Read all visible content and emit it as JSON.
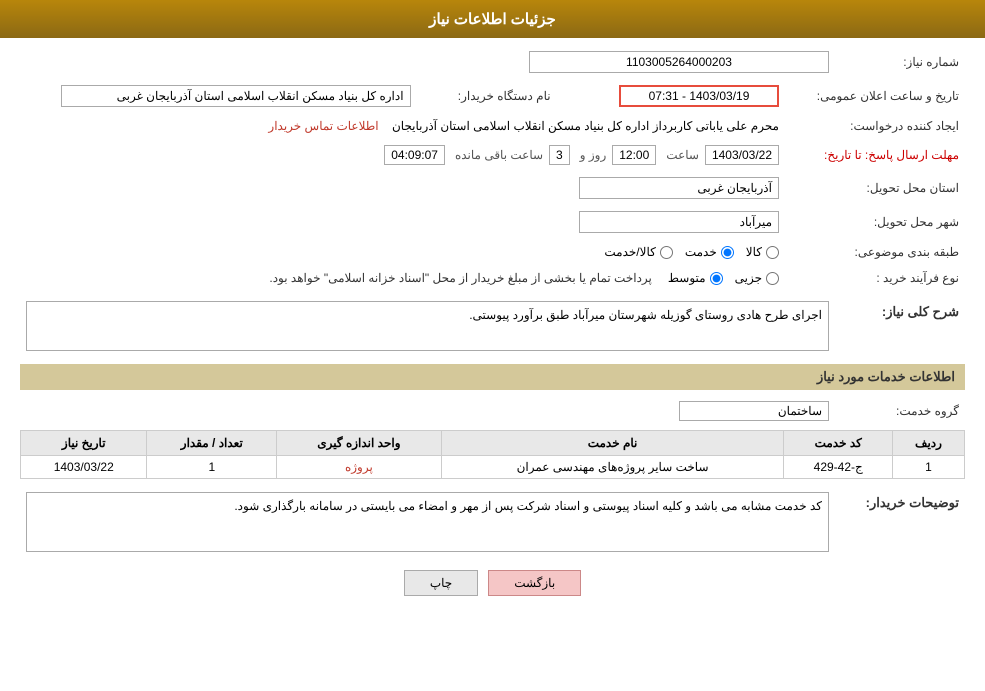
{
  "header": {
    "title": "جزئیات اطلاعات نیاز"
  },
  "fields": {
    "need_number_label": "شماره نیاز:",
    "need_number_value": "1103005264000203",
    "buyer_org_label": "نام دستگاه خریدار:",
    "buyer_org_value": "اداره کل بنیاد مسکن انقلاب اسلامی استان آذربایجان غربی",
    "creator_label": "ایجاد کننده درخواست:",
    "creator_value": "محرم علی یاباتی کاربرداز اداره کل بنیاد مسکن انقلاب اسلامی استان آذربایجان",
    "contact_link": "اطلاعات تماس خریدار",
    "announce_date_label": "تاریخ و ساعت اعلان عمومی:",
    "announce_date_value": "1403/03/19 - 07:31",
    "send_deadline_label": "مهلت ارسال پاسخ: تا تاریخ:",
    "deadline_date": "1403/03/22",
    "deadline_time_label": "ساعت",
    "deadline_time": "12:00",
    "deadline_days_label": "روز و",
    "deadline_days": "3",
    "deadline_hours_label": "ساعت باقی مانده",
    "deadline_remaining": "04:09:07",
    "province_label": "استان محل تحویل:",
    "province_value": "آذربایجان غربی",
    "city_label": "شهر محل تحویل:",
    "city_value": "میرآباد",
    "category_label": "طبقه بندی موضوعی:",
    "category_options": [
      "کالا",
      "خدمت",
      "کالا/خدمت"
    ],
    "category_selected": "خدمت",
    "process_label": "نوع فرآیند خرید :",
    "process_options": [
      "جزیی",
      "متوسط"
    ],
    "process_note": "پرداخت تمام یا بخشی از مبلغ خریدار از محل \"اسناد خزانه اسلامی\" خواهد بود.",
    "description_label": "شرح کلی نیاز:",
    "description_value": "اجرای طرح هادی روستای گوزیله شهرستان میرآباد طبق برآورد پیوستی.",
    "services_section_title": "اطلاعات خدمات مورد نیاز",
    "service_group_label": "گروه خدمت:",
    "service_group_value": "ساختمان",
    "services_table": {
      "headers": [
        "ردیف",
        "کد خدمت",
        "نام خدمت",
        "واحد اندازه گیری",
        "تعداد / مقدار",
        "تاریخ نیاز"
      ],
      "rows": [
        {
          "row": "1",
          "code": "ج-42-429",
          "name": "ساخت سایر پروژه‌های مهندسی عمران",
          "unit": "پروژه",
          "quantity": "1",
          "date": "1403/03/22"
        }
      ]
    },
    "buyer_notes_label": "توضیحات خریدار:",
    "buyer_notes_value": "کد خدمت مشابه می باشد و کلیه اسناد پیوستی و اسناد شرکت پس از مهر و امضاء می بایستی در سامانه بارگذاری شود."
  },
  "buttons": {
    "print": "چاپ",
    "back": "بازگشت"
  }
}
